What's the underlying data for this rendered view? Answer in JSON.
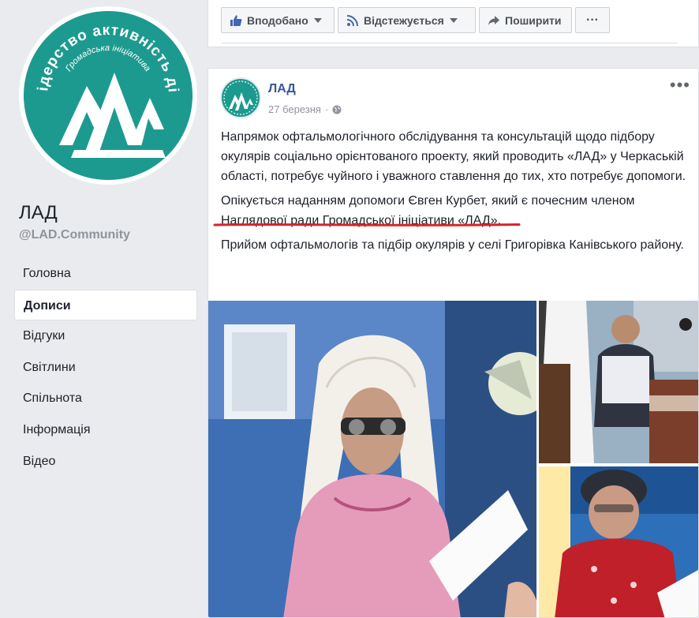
{
  "page": {
    "name": "ЛАД",
    "handle": "@LAD.Community",
    "logo_text_top": "Лідерство активність дія",
    "logo_text_inner": "Громадська ініціатива"
  },
  "nav": {
    "items": [
      {
        "label": "Головна",
        "active": false
      },
      {
        "label": "Дописи",
        "active": true
      },
      {
        "label": "Відгуки",
        "active": false
      },
      {
        "label": "Світлини",
        "active": false
      },
      {
        "label": "Спільнота",
        "active": false
      },
      {
        "label": "Інформація",
        "active": false
      },
      {
        "label": "Відео",
        "active": false
      }
    ]
  },
  "actions": {
    "liked_label": "Вподобано",
    "following_label": "Відстежується",
    "share_label": "Поширити",
    "more_label": "···"
  },
  "post": {
    "author": "ЛАД",
    "date": "27 березня",
    "dot": "·",
    "more": "•••",
    "paragraphs": [
      "Напрямок офтальмологічного обслідування та консультацій щодо підбору окулярів соціально орієнтованого проекту, який проводить «ЛАД» у Черкаській області, потребує чуйного і уважного ставлення до тих, хто потребує допомоги.",
      "Опікується наданням допомоги Євген Курбет, який є почесним членом Наглядової ради Громадської ініціативи «ЛАД».",
      "Прийом офтальмологів та підбір окулярів у селі Григорівка Канівського району."
    ]
  },
  "colors": {
    "brand_teal": "#1d9a8f",
    "link_blue": "#385898",
    "underline_red": "#d8242b",
    "background": "#e9ebee"
  }
}
